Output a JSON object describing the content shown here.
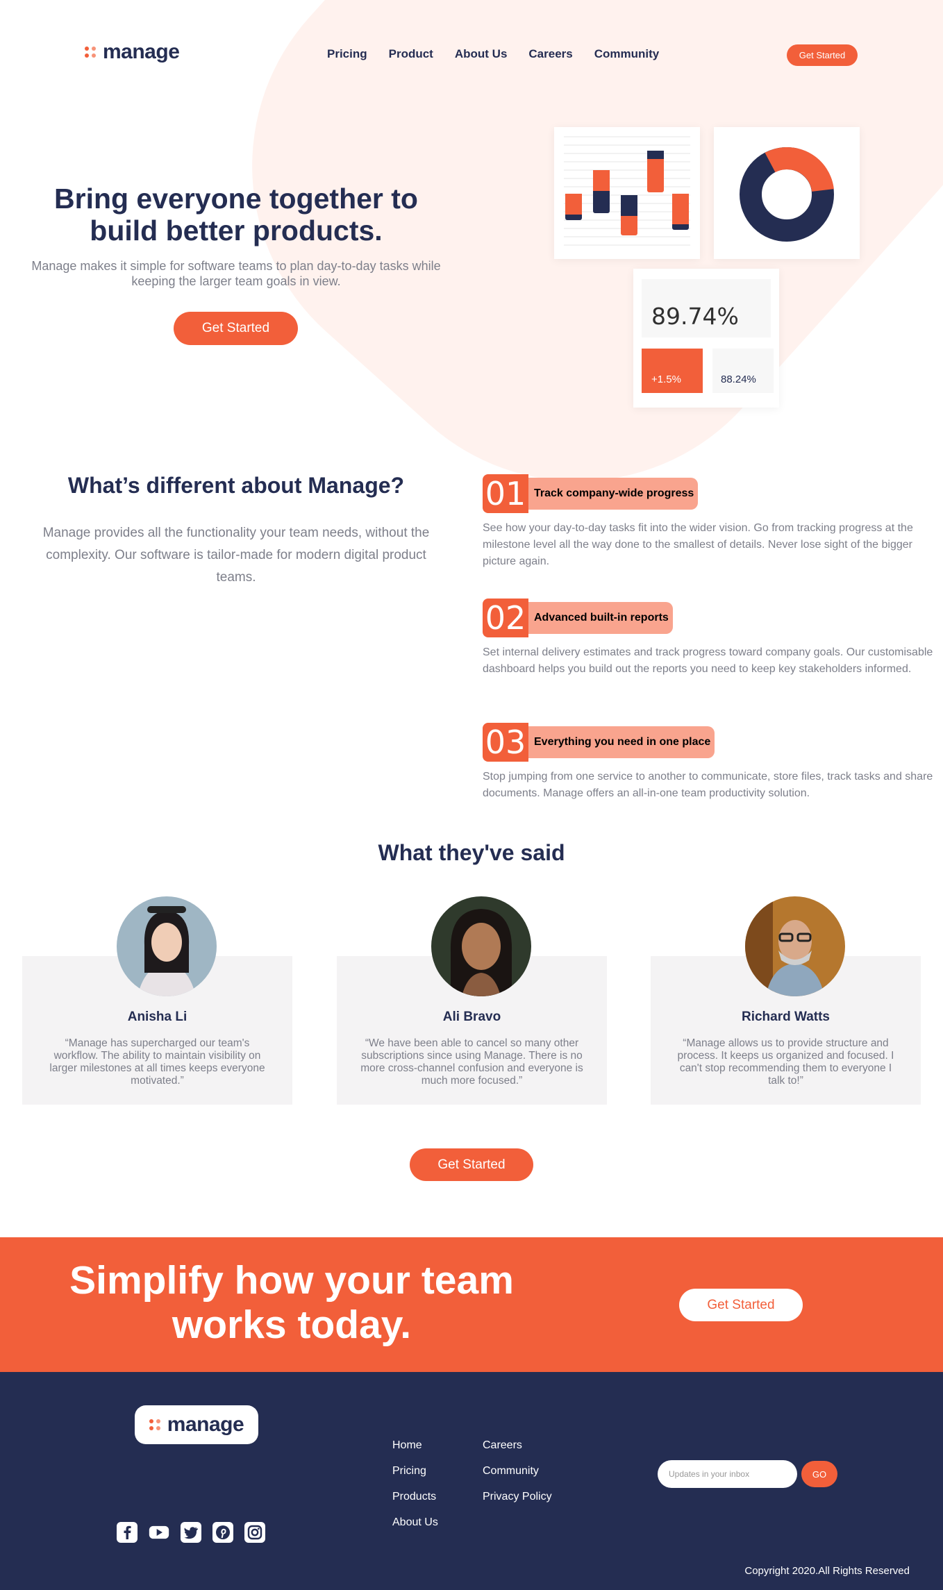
{
  "header": {
    "logo_text": "manage",
    "nav": [
      "Pricing",
      "Product",
      "About Us",
      "Careers",
      "Community"
    ],
    "cta": "Get Started"
  },
  "hero": {
    "title": "Bring everyone together to build better products.",
    "subtitle": "Manage makes it simple for software teams to plan day-to-day tasks while keeping the larger team goals in view.",
    "cta": "Get Started",
    "stats": {
      "main": "89.74%",
      "change": "+1.5%",
      "secondary": "88.24%"
    }
  },
  "different": {
    "title": "What’s different about Manage?",
    "text": "Manage provides all the functionality your team needs, without the complexity. Our software is tailor-made for modern digital product teams.",
    "features": [
      {
        "num": "01",
        "label": "Track company-wide progress",
        "desc": "See how your day-to-day tasks fit into the wider vision. Go from tracking progress at the milestone level all the way done to the smallest of details. Never lose sight of the bigger picture again."
      },
      {
        "num": "02",
        "label": "Advanced built-in reports",
        "desc": "Set internal delivery estimates and track progress toward company goals. Our customisable dashboard helps you build out the reports you need to keep key stakeholders informed."
      },
      {
        "num": "03",
        "label": "Everything you need in one place",
        "desc": "Stop jumping from one service to another to communicate, store files, track tasks and share documents. Manage offers an all-in-one team productivity solution."
      }
    ]
  },
  "testimonials": {
    "title": "What they've said",
    "items": [
      {
        "name": "Anisha Li",
        "quote": "“Manage has supercharged our team's workflow. The ability to maintain visibility on larger milestones at all times keeps everyone motivated.”"
      },
      {
        "name": "Ali Bravo",
        "quote": "“We have been able to cancel so many other subscriptions since using Manage. There is no more cross-channel confusion and everyone is much more focused.”"
      },
      {
        "name": "Richard Watts",
        "quote": "“Manage allows us to provide structure and process. It keeps us organized and focused. I can't stop recommending them to everyone I talk to!”"
      }
    ],
    "cta": "Get Started"
  },
  "cta_band": {
    "title": "Simplify how your team works today.",
    "button": "Get Started"
  },
  "footer": {
    "logo_text": "manage",
    "links_col1": [
      "Home",
      "Pricing",
      "Products",
      "About Us"
    ],
    "links_col2": [
      "Careers",
      "Community",
      "Privacy Policy"
    ],
    "socials": [
      "facebook-icon",
      "youtube-icon",
      "twitter-icon",
      "pinterest-icon",
      "instagram-icon"
    ],
    "newsletter_placeholder": "Updates in your inbox",
    "newsletter_button": "GO",
    "copyright": "Copyright 2020.All Rights Reserved"
  },
  "colors": {
    "accent": "#f25f3a",
    "navy": "#242d52",
    "peach": "#f9a48e"
  }
}
